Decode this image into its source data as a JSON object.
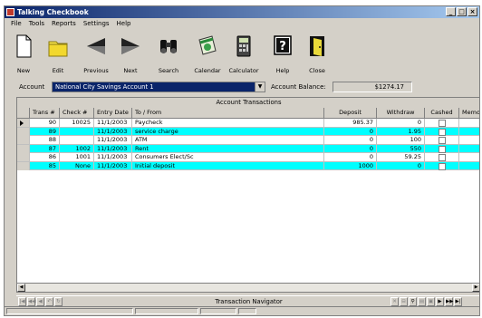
{
  "window": {
    "title": "Talking Checkbook",
    "controls": [
      "_",
      "□",
      "×"
    ]
  },
  "menu": [
    "File",
    "Tools",
    "Reports",
    "Settings",
    "Help"
  ],
  "toolbar": [
    {
      "label": "New",
      "icon": "new-file-icon"
    },
    {
      "label": "Edit",
      "icon": "edit-folder-icon"
    },
    {
      "label": "Previous",
      "icon": "previous-arrow-icon"
    },
    {
      "label": "Next",
      "icon": "next-arrow-icon"
    },
    {
      "label": "Search",
      "icon": "binoculars-icon"
    },
    {
      "label": "Calendar",
      "icon": "calendar-icon"
    },
    {
      "label": "Calculator",
      "icon": "calculator-icon"
    },
    {
      "label": "Help",
      "icon": "help-icon"
    },
    {
      "label": "Close",
      "icon": "door-exit-icon"
    }
  ],
  "account": {
    "label": "Account",
    "selected": "National City Savings Account 1",
    "balance_label": "Account Balance:",
    "balance": "$1274.17"
  },
  "grid": {
    "title": "Account Transactions",
    "columns": [
      "Trans #",
      "Check #",
      "Entry Date",
      "To / From",
      "Deposit",
      "Withdraw",
      "Cashed",
      "Memo"
    ],
    "rows": [
      {
        "trans": "90",
        "check": "10025",
        "date": "11/1/2003",
        "to_from": "Paycheck",
        "deposit": "985.37",
        "withdraw": "0",
        "highlight": false,
        "current": true
      },
      {
        "trans": "89",
        "check": "",
        "date": "11/1/2003",
        "to_from": "service charge",
        "deposit": "0",
        "withdraw": "1.95",
        "highlight": true,
        "current": false
      },
      {
        "trans": "88",
        "check": "",
        "date": "11/1/2003",
        "to_from": "ATM",
        "deposit": "0",
        "withdraw": "100",
        "highlight": false,
        "current": false
      },
      {
        "trans": "87",
        "check": "1002",
        "date": "11/1/2003",
        "to_from": "Rent",
        "deposit": "0",
        "withdraw": "550",
        "highlight": true,
        "current": false
      },
      {
        "trans": "86",
        "check": "1001",
        "date": "11/1/2003",
        "to_from": "Consumers Elect/Sc",
        "deposit": "0",
        "withdraw": "59.25",
        "highlight": false,
        "current": false
      },
      {
        "trans": "85",
        "check": "None",
        "date": "11/1/2003",
        "to_from": "Initial deposit",
        "deposit": "1000",
        "withdraw": "0",
        "highlight": true,
        "current": false
      }
    ]
  },
  "navigator": {
    "label": "Transaction Navigator"
  },
  "colors": {
    "highlight": "#00ffff",
    "titlebar": "#0a246a",
    "chrome": "#d4d0c8"
  }
}
